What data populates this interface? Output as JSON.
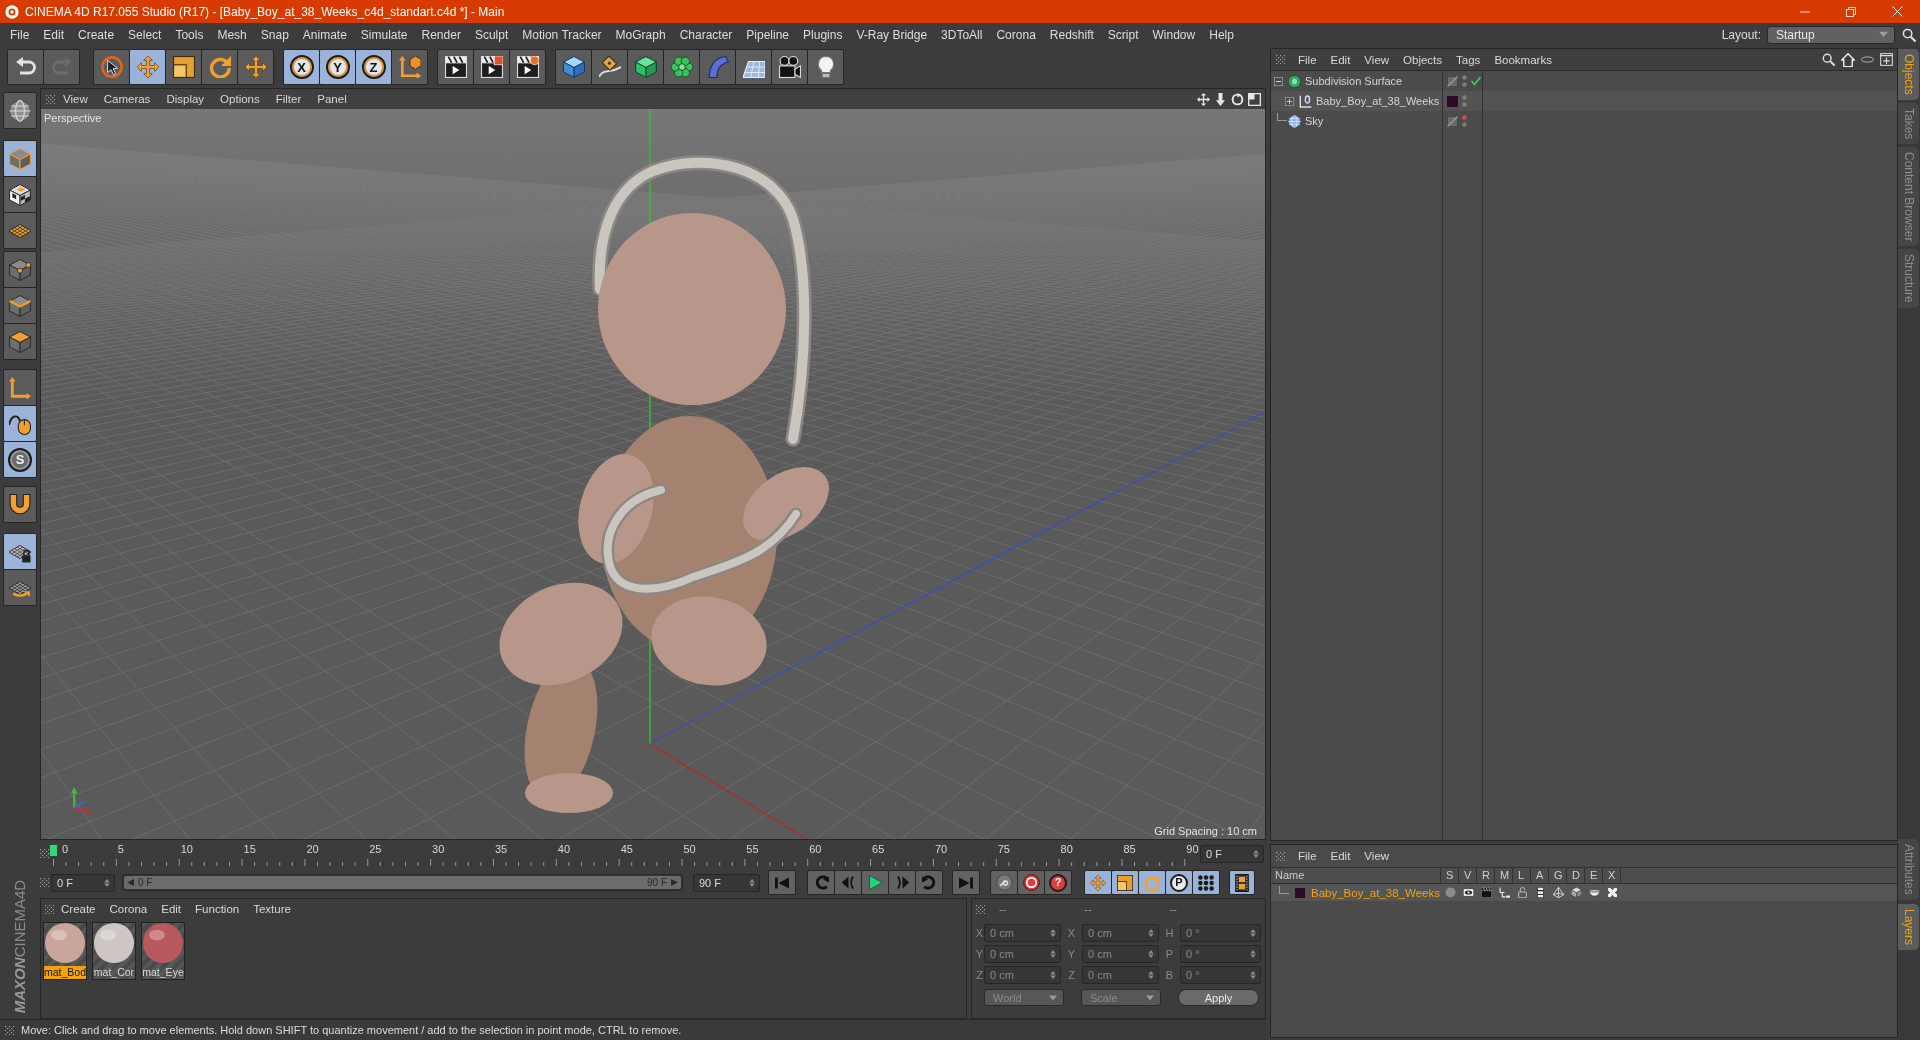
{
  "window": {
    "title": "CINEMA 4D R17.055 Studio (R17) - [Baby_Boy_at_38_Weeks_c4d_standart.c4d *] - Main"
  },
  "menu_bar": {
    "items": [
      "File",
      "Edit",
      "Create",
      "Select",
      "Tools",
      "Mesh",
      "Snap",
      "Animate",
      "Simulate",
      "Render",
      "Sculpt",
      "Motion Tracker",
      "MoGraph",
      "Character",
      "Pipeline",
      "Plugins",
      "V-Ray Bridge",
      "3DToAll",
      "Corona",
      "Redshift",
      "Script",
      "Window",
      "Help"
    ],
    "layout_label": "Layout:",
    "layout_value": "Startup"
  },
  "toolbar": {
    "history": [
      {
        "disabled": false
      },
      {
        "disabled": true
      }
    ],
    "tools": [
      {
        "selected": false
      },
      {
        "selected": true
      },
      {
        "selected": false
      },
      {
        "selected": false
      },
      {
        "selected": false
      }
    ],
    "axis_locks": [
      {
        "label": "X",
        "selected": true
      },
      {
        "label": "Y",
        "selected": true
      },
      {
        "label": "Z",
        "selected": true
      }
    ]
  },
  "left_toolbar": {
    "modes": [
      {
        "selected": true
      },
      {
        "selected": false
      },
      {
        "selected": false
      }
    ],
    "components": [
      {
        "selected": false
      },
      {
        "selected": false
      },
      {
        "selected": false
      }
    ],
    "tools": [
      {
        "selected": false
      },
      {
        "selected": true
      }
    ],
    "snap": {
      "label": "S",
      "selected": true
    },
    "magnet": {
      "selected": false
    },
    "workplane": [
      {
        "selected": true
      },
      {
        "selected": false
      }
    ],
    "logo": {
      "brand": "MAXON",
      "product": "CINEMA4D"
    }
  },
  "viewport": {
    "menu": [
      "View",
      "Cameras",
      "Display",
      "Options",
      "Filter",
      "Panel"
    ],
    "camera": "Perspective",
    "grid_spacing": "Grid Spacing : 10 cm"
  },
  "timeline": {
    "ruler": [
      "0",
      "5",
      "10",
      "15",
      "20",
      "25",
      "30",
      "35",
      "40",
      "45",
      "50",
      "55",
      "60",
      "65",
      "70",
      "75",
      "80",
      "85",
      "90"
    ],
    "level": 0,
    "current_frame": "0 F"
  },
  "transport": {
    "start_frame": "0 F",
    "range": {
      "start": "0 F",
      "end": "90 F",
      "level": 1
    },
    "end_frame": "90 F"
  },
  "key_controls": {
    "record_disabled": true,
    "help_label": "?",
    "tracks": [
      {
        "selected": true
      },
      {
        "selected": true
      },
      {
        "selected": true
      },
      {
        "label": "P",
        "selected": true
      },
      {
        "selected": true
      }
    ],
    "timeline_selected": true
  },
  "materials": {
    "menu": [
      "Create",
      "Corona",
      "Edit",
      "Function",
      "Texture"
    ],
    "items": [
      {
        "name": "mat_Bod",
        "color": "#c9a59b",
        "selected": true
      },
      {
        "name": "mat_Cor",
        "color": "#cdc6c3",
        "selected": false
      },
      {
        "name": "mat_Eye",
        "color": "#b9585e",
        "selected": false
      }
    ]
  },
  "coordinates": {
    "disabled": true,
    "headers": [
      "--",
      "--",
      "--"
    ],
    "rows": [
      {
        "axis": "X",
        "position": "0 cm",
        "size_axis": "X",
        "size": "0 cm",
        "rotation_axis": "H",
        "rotation": "0 °"
      },
      {
        "axis": "Y",
        "position": "0 cm",
        "size_axis": "Y",
        "size": "0 cm",
        "rotation_axis": "P",
        "rotation": "0 °"
      },
      {
        "axis": "Z",
        "position": "0 cm",
        "size_axis": "Z",
        "size": "0 cm",
        "rotation_axis": "B",
        "rotation": "0 °"
      }
    ],
    "space": "World",
    "size_mode": "Scale",
    "apply": "Apply"
  },
  "status_bar": {
    "text": "Move: Click and drag to move elements. Hold down SHIFT to quantize movement / add to the selection in point mode, CTRL to remove."
  },
  "object_manager": {
    "menu": [
      "File",
      "Edit",
      "View",
      "Objects",
      "Tags",
      "Bookmarks"
    ],
    "objects": [
      {
        "name": "Subdivision Surface",
        "kind": "subdivision",
        "expanded": true,
        "editor_visible": true,
        "enabled": true,
        "children": [
          {
            "name": "Baby_Boy_at_38_Weeks",
            "kind": "null",
            "expanded": false,
            "color": "#2e0a28",
            "editor_visible": true
          }
        ]
      },
      {
        "name": "Sky",
        "kind": "sky",
        "editor_visible": false
      }
    ]
  },
  "layers_manager": {
    "menu": [
      "File",
      "Edit",
      "View"
    ],
    "columns": [
      "Name",
      "S",
      "V",
      "R",
      "M",
      "L",
      "A",
      "G",
      "D",
      "E",
      "X"
    ],
    "layers": [
      {
        "name": "Baby_Boy_at_38_Weeks",
        "color": "#2e0a28",
        "selected": true
      }
    ]
  },
  "side_tabs": {
    "top": [
      {
        "label": "Objects",
        "selected": true
      },
      {
        "label": "Takes",
        "selected": false
      },
      {
        "label": "Content Browser",
        "selected": false
      },
      {
        "label": "Structure",
        "selected": false
      }
    ],
    "bottom": [
      {
        "label": "Attributes",
        "selected": false
      },
      {
        "label": "Layers",
        "selected": true
      }
    ]
  }
}
